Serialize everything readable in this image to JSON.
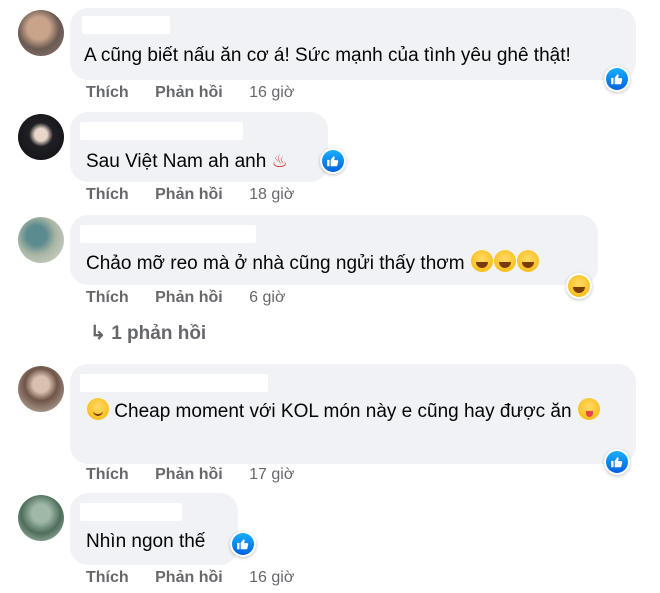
{
  "comments": [
    {
      "text": "A cũng biết nấu ăn cơ á! Sức mạnh của tình yêu ghê thật!",
      "like": "Thích",
      "reply": "Phản hồi",
      "time": "16 giờ"
    },
    {
      "text": "Sau Việt Nam ah anh",
      "emoji": "♨",
      "like": "Thích",
      "reply": "Phản hồi",
      "time": "18 giờ"
    },
    {
      "text": "Chảo mỡ reo mà ở nhà cũng ngửi thấy thơm",
      "like": "Thích",
      "reply": "Phản hồi",
      "time": "6 giờ"
    },
    {
      "text": "Cheap moment với KOL món này e cũng hay được ăn",
      "like": "Thích",
      "reply": "Phản hồi",
      "time": "17 giờ"
    },
    {
      "text": "Nhìn ngon thế",
      "like": "Thích",
      "reply": "Phản hồi",
      "time": "16 giờ"
    }
  ],
  "replies_link": {
    "arrow": "↳",
    "label": "1 phản hồi"
  },
  "icons": {
    "reaction": "like-icon",
    "emojis": [
      "steam-icon",
      "laugh-cry-icon",
      "relieved-icon",
      "yum-icon"
    ]
  },
  "colors": {
    "bubble": "#f0f2f5",
    "meta": "#65676b",
    "like_blue": "#1877f2"
  }
}
